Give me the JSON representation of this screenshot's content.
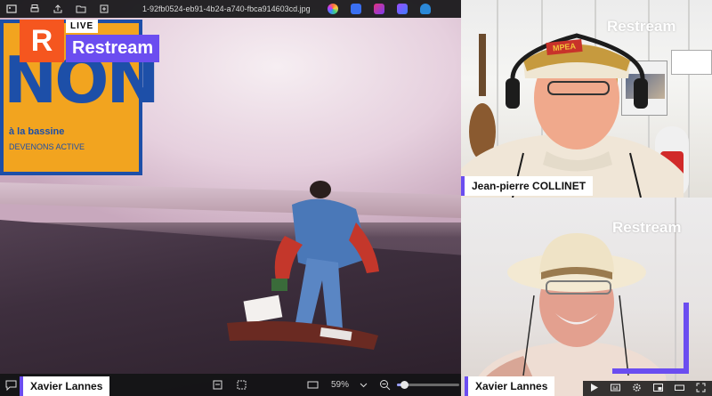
{
  "viewer": {
    "file_title": "1-92fb0524-eb91-4b24-a740-fbca914603cd.jpg",
    "zoom_level": "59%",
    "zoom_fraction": 0.12
  },
  "branding": {
    "logo_letter": "R",
    "live_label": "LIVE",
    "brand_name": "Restream",
    "accent_color": "#6b4df0",
    "logo_color": "#f5561f"
  },
  "main_video": {
    "poster_word": "NON",
    "poster_sub": "à la bassine",
    "poster_sub2": "DEVENONS ACTIVE",
    "speaker_name": "Xavier Lannes"
  },
  "panels": [
    {
      "brand": "Restream",
      "speaker_name": "Jean-pierre COLLINET",
      "cap_text": "MPEA"
    },
    {
      "brand": "Restream",
      "speaker_name": "Xavier Lannes"
    }
  ],
  "icons": {
    "toolbar": [
      "gallery-icon",
      "print-icon",
      "share-icon",
      "folder-icon",
      "add-folder-icon"
    ],
    "apps": [
      "copilot-icon",
      "edit-icon",
      "clipchamp-icon",
      "designer-icon",
      "cloud-icon"
    ],
    "controls": [
      "play-icon",
      "captions-icon",
      "settings-icon",
      "pip-icon",
      "theater-icon",
      "fullscreen-icon"
    ]
  }
}
